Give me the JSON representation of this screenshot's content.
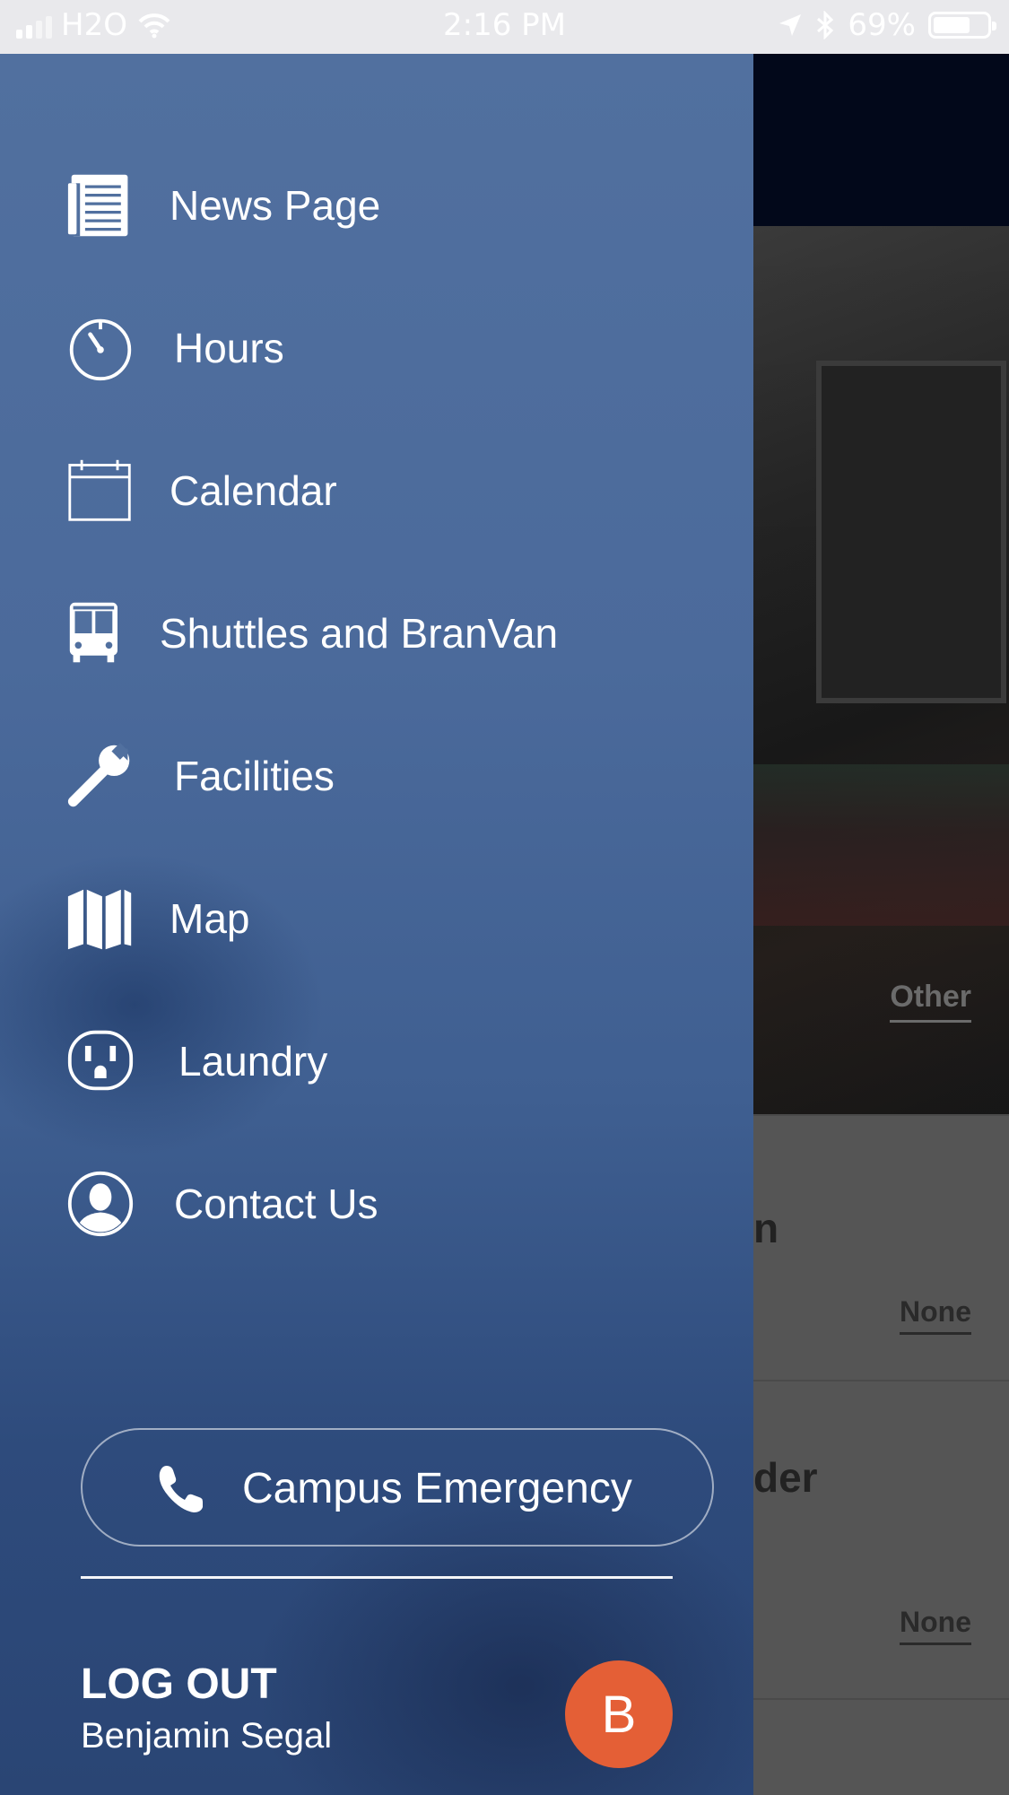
{
  "status_bar": {
    "carrier": "H2O",
    "time": "2:16 PM",
    "battery": "69%",
    "battery_level": 0.69
  },
  "drawer": {
    "items": [
      {
        "label": "News Page",
        "icon": "newspaper-icon"
      },
      {
        "label": "Hours",
        "icon": "stopwatch-icon"
      },
      {
        "label": "Calendar",
        "icon": "calendar-icon"
      },
      {
        "label": "Shuttles and BranVan",
        "icon": "bus-icon"
      },
      {
        "label": "Facilities",
        "icon": "wrench-icon"
      },
      {
        "label": "Map",
        "icon": "map-icon"
      },
      {
        "label": "Laundry",
        "icon": "outlet-icon"
      },
      {
        "label": "Contact Us",
        "icon": "person-icon"
      }
    ],
    "emergency_label": "Campus Emergency",
    "logout_label": "LOG OUT",
    "user_name": "Benjamin Segal",
    "avatar_initial": "B"
  },
  "background": {
    "hero_tab": "Other",
    "rows": [
      {
        "title_fragment": "n",
        "value": "None"
      },
      {
        "title_fragment": "der",
        "value": "None"
      }
    ]
  },
  "colors": {
    "drawer_top": "#51709f",
    "drawer_bottom": "#2a4574",
    "avatar": "#e45f36"
  }
}
